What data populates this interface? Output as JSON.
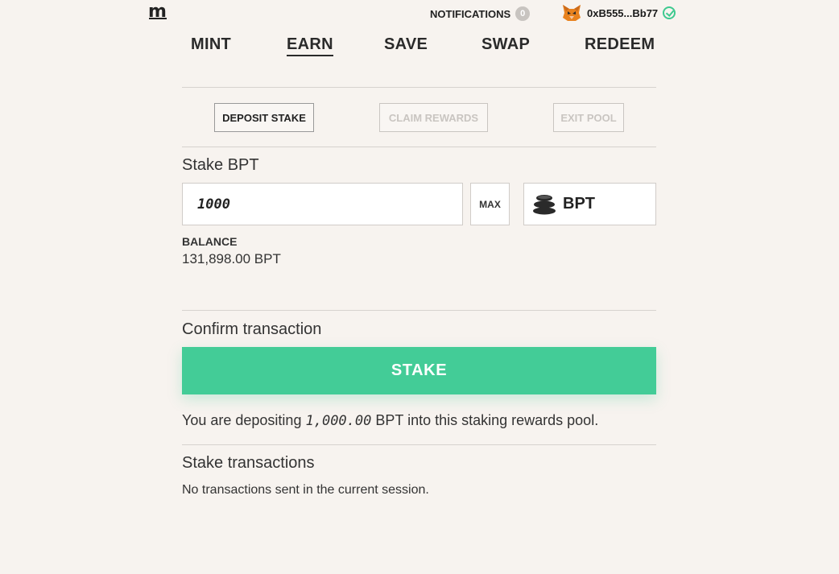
{
  "brand": {
    "logo": "m"
  },
  "header": {
    "notifications_label": "NOTIFICATIONS",
    "notifications_count": "0",
    "wallet_address": "0xB555...Bb77",
    "wallet_icon": "metamask-fox-icon",
    "connected_icon": "check-circle-icon",
    "accent_color": "#43cc97"
  },
  "nav": {
    "items": [
      {
        "label": "MINT",
        "active": false
      },
      {
        "label": "EARN",
        "active": true
      },
      {
        "label": "SAVE",
        "active": false
      },
      {
        "label": "SWAP",
        "active": false
      },
      {
        "label": "REDEEM",
        "active": false
      }
    ]
  },
  "subtabs": [
    {
      "label": "DEPOSIT STAKE",
      "active": true
    },
    {
      "label": "CLAIM REWARDS",
      "active": false
    },
    {
      "label": "EXIT POOL",
      "active": false
    }
  ],
  "stake": {
    "title": "Stake BPT",
    "amount_value": "1000",
    "max_label": "MAX",
    "token_symbol": "BPT",
    "token_icon": "bpt-coins-icon",
    "balance_label": "BALANCE",
    "balance_value": "131,898.00 BPT"
  },
  "confirm": {
    "title": "Confirm transaction",
    "button_label": "STAKE",
    "summary_prefix": "You are depositing",
    "summary_amount": "1,000.00",
    "summary_suffix": "BPT into this staking rewards pool."
  },
  "transactions": {
    "title": "Stake transactions",
    "empty_text": "No transactions sent in the current session."
  }
}
